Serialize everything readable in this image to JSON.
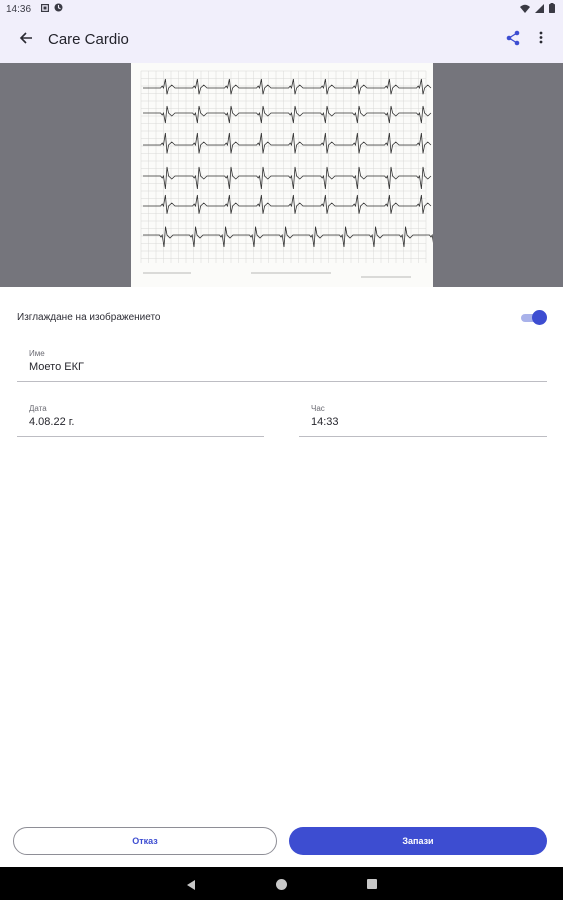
{
  "status_bar": {
    "time": "14:36",
    "icons_left": [
      "notification-square-icon",
      "sync-icon"
    ],
    "icons_right": [
      "wifi-icon",
      "signal-icon",
      "battery-icon"
    ]
  },
  "app_bar": {
    "title": "Care Cardio",
    "back_icon": "arrow-back-icon",
    "share_icon": "share-icon",
    "menu_icon": "more-vert-icon"
  },
  "image_smoothing": {
    "label": "Изглаждане на изображението",
    "enabled": true
  },
  "form": {
    "name": {
      "label": "Име",
      "value": "Моето ЕКГ"
    },
    "date": {
      "label": "Дата",
      "value": "4.08.22 г."
    },
    "time": {
      "label": "Час",
      "value": "14:33"
    }
  },
  "buttons": {
    "cancel": "Отказ",
    "save": "Запази"
  },
  "colors": {
    "accent": "#3d4dd1",
    "app_bar_bg": "#f1effb",
    "preview_bg": "#75757c"
  },
  "nav_bar": {
    "icons": [
      "nav-back-icon",
      "nav-home-icon",
      "nav-recents-icon"
    ]
  }
}
